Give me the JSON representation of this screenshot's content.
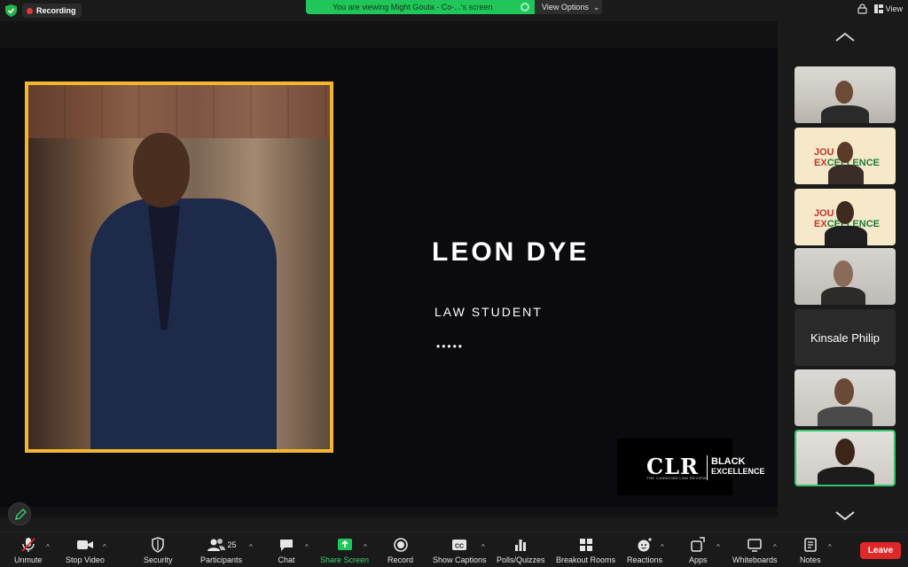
{
  "topbar": {
    "recording_label": "Recording",
    "share_banner_text": "You are viewing Might Gouta - Co-...'s screen",
    "view_options_label": "View Options",
    "view_label": "View"
  },
  "slide": {
    "name": "LEON DYE",
    "title": "LAW STUDENT",
    "dots": "•••••",
    "logo": {
      "clr": "CLR",
      "subtitle": "THE CANADIAN LAW REVIEW",
      "black": "BLACK",
      "excellence": "EXCELLENCE"
    }
  },
  "gallery": {
    "named_tile": "Kinsale Philip",
    "journey_text_line1": "JOU",
    "journey_text_line2": "EX",
    "journey_text_line2b": "CELLENCE"
  },
  "toolbar": {
    "unmute": "Unmute",
    "stop_video": "Stop Video",
    "security": "Security",
    "participants": "Participants",
    "participants_count": "25",
    "chat": "Chat",
    "share_screen": "Share Screen",
    "record": "Record",
    "show_captions": "Show Captions",
    "polls": "Polls/Quizzes",
    "breakout": "Breakout Rooms",
    "reactions": "Reactions",
    "apps": "Apps",
    "whiteboards": "Whiteboards",
    "notes": "Notes",
    "leave": "Leave"
  },
  "colors": {
    "accent_green": "#21c65a",
    "frame_gold": "#f2b72e",
    "leave_red": "#e02828"
  }
}
